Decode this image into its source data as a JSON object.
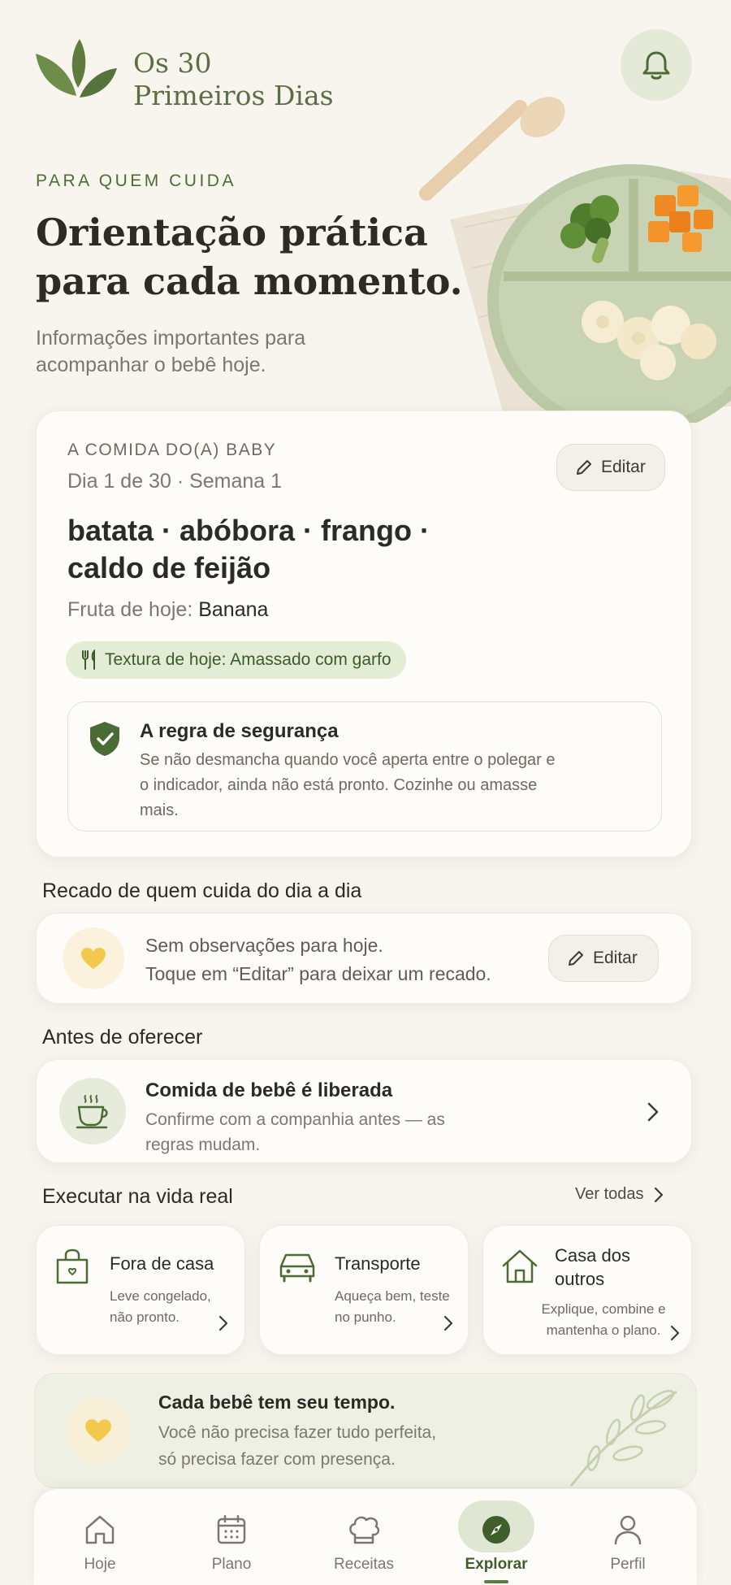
{
  "app": {
    "brand_line1": "Os 30",
    "brand_line2": "Primeiros Dias"
  },
  "hero": {
    "eyebrow": "PARA QUEM CUIDA",
    "title_line1": "Orientação prática",
    "title_line2": "para cada momento.",
    "subtitle": "Informações importantes para acompanhar o bebê hoje."
  },
  "food_card": {
    "label": "A COMIDA DO(A) BABY",
    "day_line": "Dia 1 de 30 · Semana 1",
    "edit_label": "Editar",
    "menu_line1": "batata · abóbora · frango ·",
    "menu_line2": "caldo de feijão",
    "fruit_label": "Fruta de hoje:",
    "fruit_value": "Banana",
    "texture": "Textura de hoje: Amassado com garfo",
    "safety_title": "A regra de segurança",
    "safety_text": "Se não desmancha quando você aperta entre o polegar e o indicador, ainda não está pronto. Cozinhe ou amasse mais."
  },
  "note": {
    "section_title": "Recado de quem cuida do dia a dia",
    "line1": "Sem observações para hoje.",
    "line2": "Toque em “Editar” para deixar um recado.",
    "edit_label": "Editar"
  },
  "offer": {
    "section_title": "Antes de oferecer",
    "title": "Comida de bebê é liberada",
    "subtitle": "Confirme com a companhia antes — as regras mudam."
  },
  "real_life": {
    "section_title": "Executar na vida real",
    "see_all": "Ver todas",
    "tiles": [
      {
        "title": "Fora de casa",
        "subtitle": "Leve congelado, não pronto.",
        "icon": "bag-icon"
      },
      {
        "title": "Transporte",
        "subtitle": "Aqueça bem, teste no punho.",
        "icon": "car-icon"
      },
      {
        "title": "Casa dos outros",
        "subtitle": "Explique, combine e mantenha o plano.",
        "icon": "house-icon"
      }
    ]
  },
  "quote": {
    "title": "Cada bebê tem seu tempo.",
    "line1": "Você não precisa fazer tudo perfeita,",
    "line2": "só precisa fazer com presença."
  },
  "nav": {
    "items": [
      {
        "label": "Hoje",
        "icon": "home-icon"
      },
      {
        "label": "Plano",
        "icon": "calendar-icon"
      },
      {
        "label": "Receitas",
        "icon": "chef-hat-icon"
      },
      {
        "label": "Explorar",
        "icon": "compass-icon",
        "active": true
      },
      {
        "label": "Perfil",
        "icon": "user-icon"
      }
    ]
  },
  "colors": {
    "background": "#f8f5ef",
    "accent_green": "#4c6b35",
    "soft_green": "#e3edd6",
    "card": "#fdfcf9",
    "heart_yellow": "#f2c94c"
  }
}
